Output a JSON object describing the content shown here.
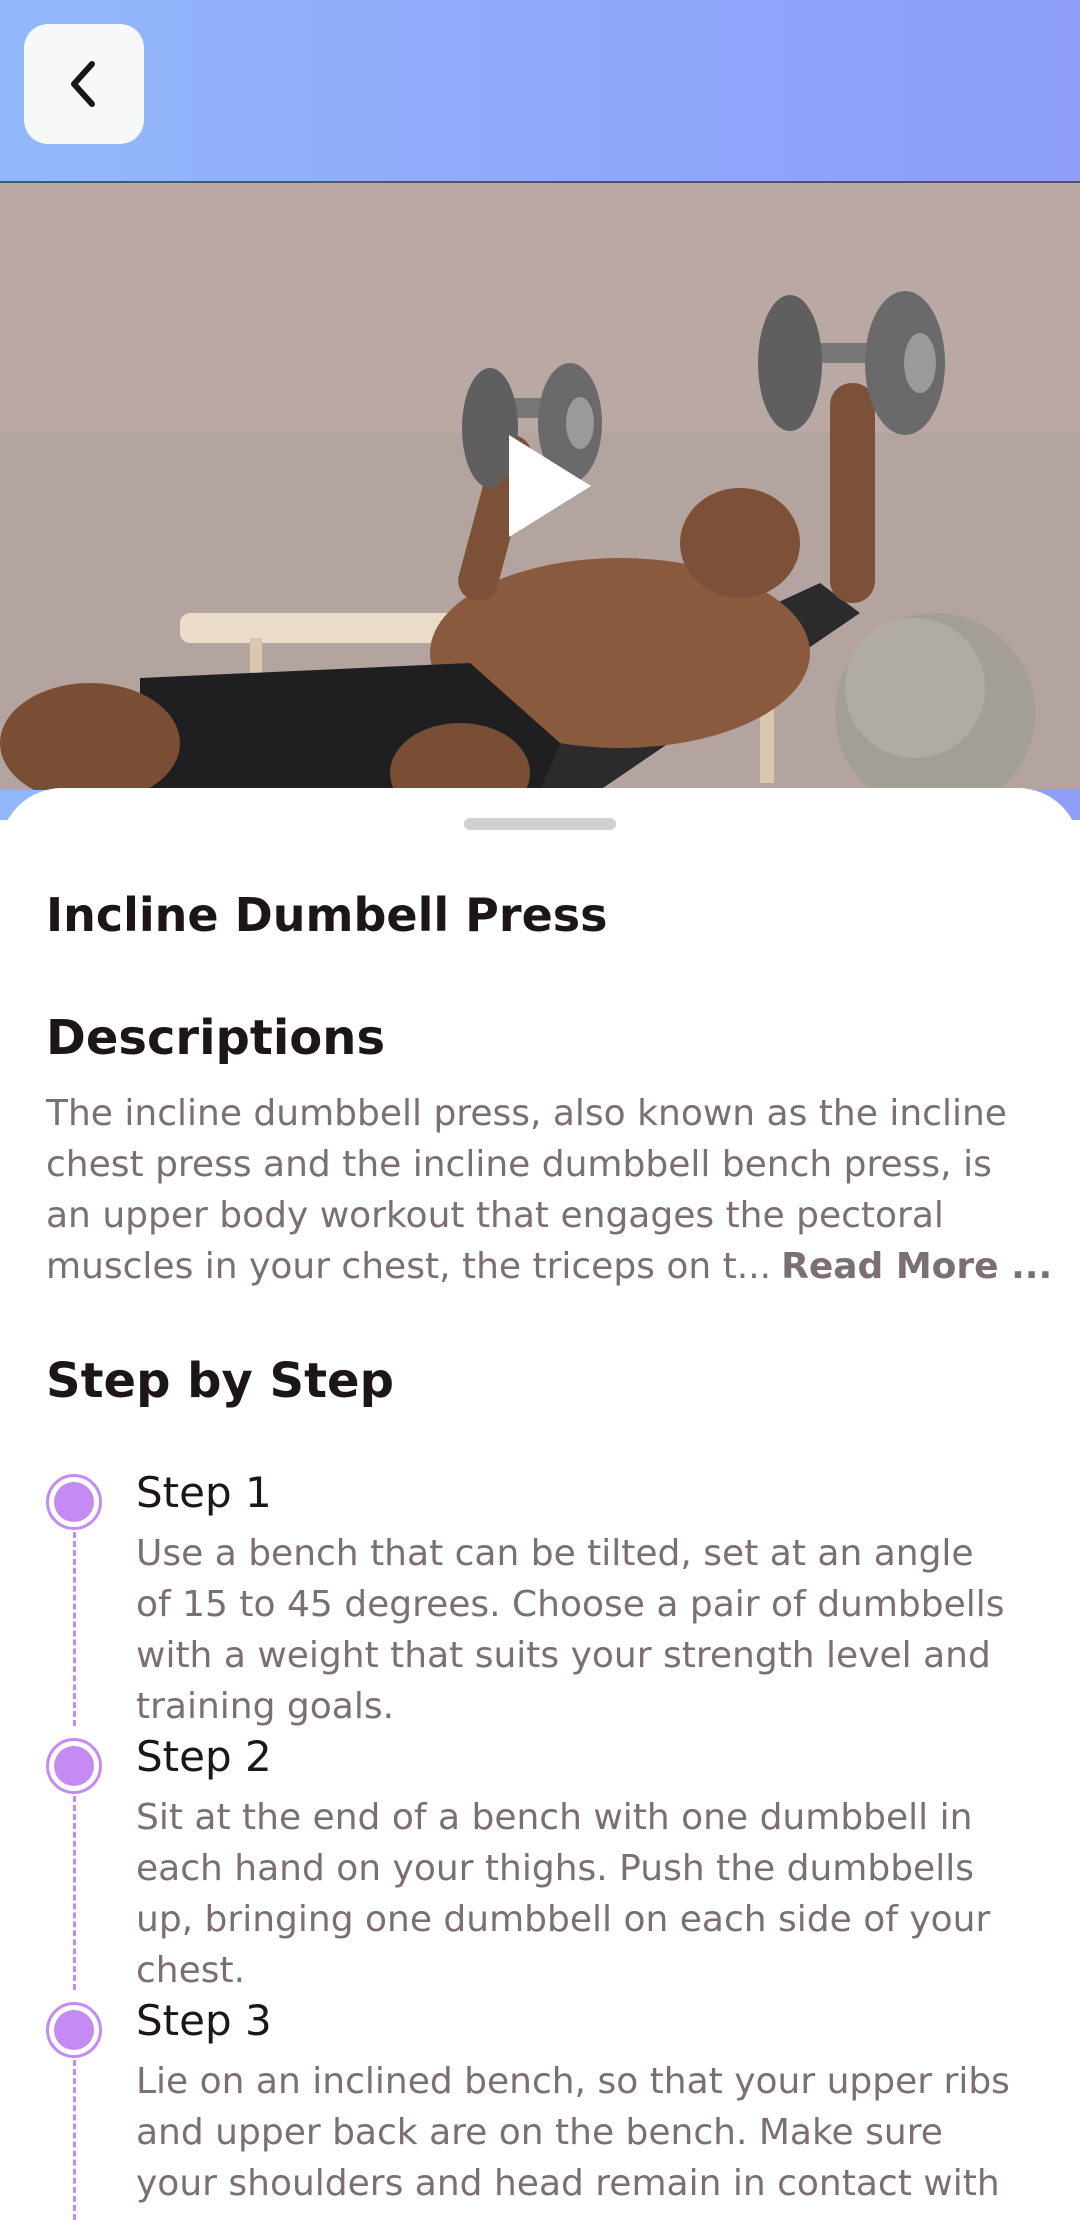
{
  "header": {
    "back_icon": "chevron-left-icon"
  },
  "video": {
    "play_icon": "play-icon"
  },
  "exercise": {
    "title": "Incline Dumbell Press"
  },
  "description": {
    "heading": "Descriptions",
    "lines": [
      "The incline dumbbell press, also known as the incline",
      "chest press and the incline dumbbell bench press, is",
      "an upper body workout that engages the pectoral",
      "muscles in your chest, the triceps on t..."
    ],
    "read_more": "Read More ..."
  },
  "steps_section": {
    "heading": "Step by Step"
  },
  "steps": [
    {
      "title": "Step 1",
      "lines": [
        "Use a bench that can be tilted, set at an angle",
        "of 15 to 45 degrees. Choose a pair of dumbbells",
        "with a weight that suits your strength level and",
        "training goals."
      ]
    },
    {
      "title": "Step 2",
      "lines": [
        "Sit at the end of a bench with one dumbbell in",
        "each hand on your thighs. Push the dumbbells",
        "up, bringing one dumbbell on each side of your",
        "chest."
      ]
    },
    {
      "title": "Step 3",
      "lines": [
        "Lie on an inclined bench, so that your upper ribs",
        "and upper back are on the bench. Make sure",
        "your shoulders and head remain in contact with"
      ]
    }
  ],
  "colors": {
    "accent": "#C58BF2",
    "header_gradient_start": "#92B8FB",
    "header_gradient_end": "#8E9EF9",
    "text_dark": "#1D1617",
    "text_gray": "#7B6F72"
  }
}
